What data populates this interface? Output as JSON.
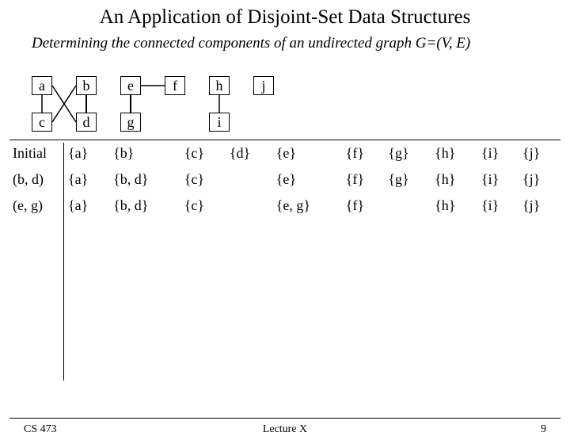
{
  "title": "An Application of Disjoint-Set Data Structures",
  "subtitle": "Determining the connected components of an undirected graph G=(V, E)",
  "nodes": {
    "a": "a",
    "b": "b",
    "c": "c",
    "d": "d",
    "e": "e",
    "f": "f",
    "g": "g",
    "h": "h",
    "i": "i",
    "j": "j"
  },
  "table": {
    "rows": [
      {
        "op": "Initial",
        "c": [
          "{a}",
          "{b}",
          "{c}",
          "{d}",
          "{e}",
          "{f}",
          "{g}",
          "{h}",
          "{i}",
          "{j}"
        ]
      },
      {
        "op": "(b, d)",
        "c": [
          "{a}",
          "{b, d}",
          "{c}",
          "",
          "{e}",
          "{f}",
          "{g}",
          "{h}",
          "{i}",
          "{j}"
        ]
      },
      {
        "op": "(e, g)",
        "c": [
          "{a}",
          "{b, d}",
          "{c}",
          "",
          "{e, g}",
          "{f}",
          "",
          "{h}",
          "{i}",
          "{j}"
        ]
      }
    ]
  },
  "footer": {
    "left": "CS 473",
    "center": "Lecture X",
    "right": "9"
  }
}
